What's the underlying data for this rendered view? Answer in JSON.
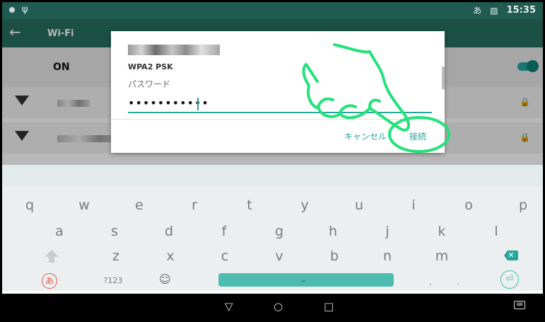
{
  "status_bar": {
    "time": "15:35",
    "ime_indicator": "あ"
  },
  "wifi_settings": {
    "title": "Wi-Fi",
    "switch_label": "ON"
  },
  "dialog": {
    "security": "WPA2 PSK",
    "password_label": "パスワード",
    "password_value": "•••••••••••",
    "cancel": "キャンセル",
    "connect": "接続"
  },
  "keyboard": {
    "row1": [
      "q",
      "w",
      "e",
      "r",
      "t",
      "y",
      "u",
      "i",
      "o",
      "p"
    ],
    "row2": [
      "a",
      "s",
      "d",
      "f",
      "g",
      "h",
      "j",
      "k",
      "l"
    ],
    "row3": [
      "z",
      "x",
      "c",
      "v",
      "b",
      "n",
      "m"
    ],
    "kana": "あ",
    "numeric": "?123",
    "punctuation": ", ."
  },
  "colors": {
    "accent": "#26a69a",
    "annotation": "#22e27a",
    "app_bar": "#28705f"
  }
}
